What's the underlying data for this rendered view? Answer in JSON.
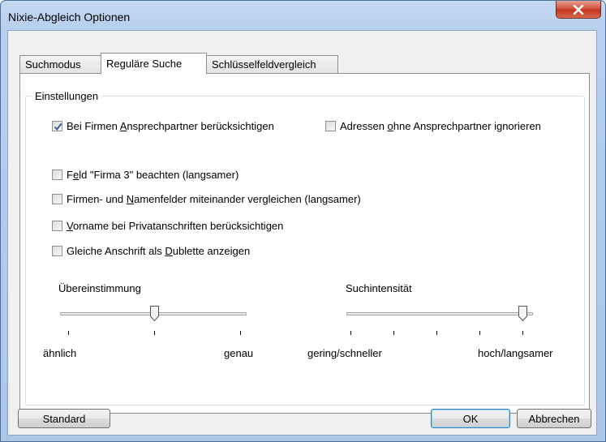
{
  "window": {
    "title": "Nixie-Abgleich Optionen",
    "close_icon": "close-icon"
  },
  "tabs": [
    {
      "label": "Suchmodus",
      "active": false
    },
    {
      "label": "Reguläre Suche",
      "active": true
    },
    {
      "label": "Schlüsselfeldvergleich",
      "active": false
    }
  ],
  "group": {
    "title": "Einstellungen"
  },
  "checkboxes": {
    "firmen_ansprechpartner": {
      "pre": "Bei Firmen ",
      "key": "A",
      "post": "nsprechpartner berücksichtigen",
      "checked": true
    },
    "ohne_ansprechpartner": {
      "pre": "Adressen ",
      "key": "o",
      "post": "hne Ansprechpartner ignorieren",
      "checked": false
    },
    "feld_firma3": {
      "pre": "F",
      "key": "e",
      "post": "ld \"Firma 3\" beachten (langsamer)",
      "checked": false
    },
    "namenfelder": {
      "pre": "Firmen- und ",
      "key": "N",
      "post": "amenfelder miteinander vergleichen (langsamer)",
      "checked": false
    },
    "vorname": {
      "pre": "",
      "key": "V",
      "post": "orname bei Privatanschriften berücksichtigen",
      "checked": false
    },
    "dublette": {
      "pre": "Gleiche Anschrift als ",
      "key": "D",
      "post": "ublette anzeigen",
      "checked": false
    }
  },
  "slider_uebereinstimmung": {
    "label": "Übereinstimmung",
    "min_label": "ähnlich",
    "max_label": "genau",
    "steps": 3,
    "value_index": 1
  },
  "slider_suchintensitaet": {
    "label": "Suchintensität",
    "min_label": "gering/schneller",
    "max_label": "hoch/langsamer",
    "steps": 5,
    "value_index": 4
  },
  "buttons": {
    "standard": "Standard",
    "ok": "OK",
    "cancel": "Abbrechen"
  },
  "colors": {
    "check": "#3a5c99",
    "thumb_border": "#555555"
  }
}
